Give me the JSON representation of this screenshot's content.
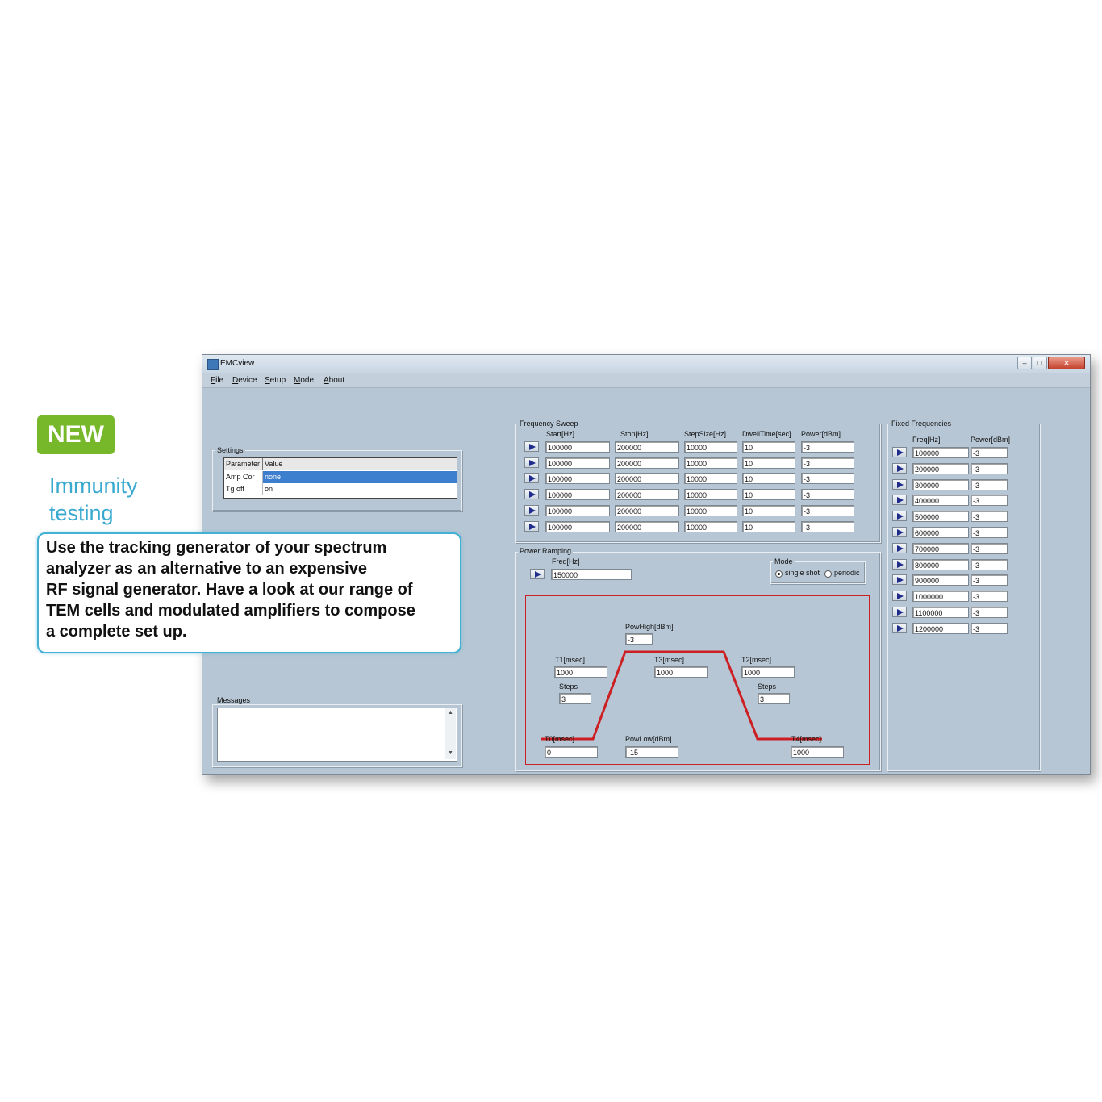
{
  "promo": {
    "badge": "NEW",
    "heading_line1": "Immunity",
    "heading_line2": "testing",
    "description_lines": [
      "Use the tracking generator of your spectrum",
      "analyzer as an alternative to an expensive",
      "RF signal generator. Have a look at our range of",
      "TEM cells and modulated amplifiers to compose",
      "a complete set up."
    ]
  },
  "window": {
    "title": "EMCview",
    "menu": [
      "File",
      "Device",
      "Setup",
      "Mode",
      "About"
    ]
  },
  "settings": {
    "label": "Settings",
    "headers": [
      "Parameter",
      "Value"
    ],
    "rows": [
      {
        "param": "Amp Cor",
        "value": "none",
        "selected": true
      },
      {
        "param": "Tg off",
        "value": "on",
        "selected": false
      }
    ]
  },
  "messages": {
    "label": "Messages",
    "text": ""
  },
  "frequency_sweep": {
    "label": "Frequency Sweep",
    "headers": [
      "Start[Hz]",
      "Stop[Hz]",
      "StepSize[Hz]",
      "DwellTime[sec]",
      "Power[dBm]"
    ],
    "rows": [
      [
        "100000",
        "200000",
        "10000",
        "10",
        "-3"
      ],
      [
        "100000",
        "200000",
        "10000",
        "10",
        "-3"
      ],
      [
        "100000",
        "200000",
        "10000",
        "10",
        "-3"
      ],
      [
        "100000",
        "200000",
        "10000",
        "10",
        "-3"
      ],
      [
        "100000",
        "200000",
        "10000",
        "10",
        "-3"
      ],
      [
        "100000",
        "200000",
        "10000",
        "10",
        "-3"
      ]
    ]
  },
  "power_ramping": {
    "label": "Power Ramping",
    "freq_label": "Freq[Hz]",
    "freq_value": "150000",
    "mode_label": "Mode",
    "mode_options": [
      "single shot",
      "periodic"
    ],
    "mode_selected": "single shot",
    "pow_high_label": "PowHigh[dBm]",
    "pow_high_value": "-3",
    "pow_low_label": "PowLow[dBm]",
    "pow_low_value": "-15",
    "t0_label": "T0[msec]",
    "t0_value": "0",
    "t1_label": "T1[msec]",
    "t1_value": "1000",
    "t2_label": "T2[msec]",
    "t2_value": "1000",
    "t3_label": "T3[msec]",
    "t3_value": "1000",
    "t4_label": "T4[msec]",
    "t4_value": "1000",
    "steps_label": "Steps",
    "steps_up_value": "3",
    "steps_down_value": "3",
    "ramp_color": "#cc1f24"
  },
  "fixed_frequencies": {
    "label": "Fixed Frequencies",
    "headers": [
      "Freq[Hz]",
      "Power[dBm]"
    ],
    "rows": [
      [
        "100000",
        "-3"
      ],
      [
        "200000",
        "-3"
      ],
      [
        "300000",
        "-3"
      ],
      [
        "400000",
        "-3"
      ],
      [
        "500000",
        "-3"
      ],
      [
        "600000",
        "-3"
      ],
      [
        "700000",
        "-3"
      ],
      [
        "800000",
        "-3"
      ],
      [
        "900000",
        "-3"
      ],
      [
        "1000000",
        "-3"
      ],
      [
        "1100000",
        "-3"
      ],
      [
        "1200000",
        "-3"
      ]
    ]
  },
  "colors": {
    "window_bg": "#b7c6d4",
    "badge_green": "#76b82a",
    "heading_blue": "#3aa9cf",
    "selection_blue": "#3d7fcf"
  }
}
